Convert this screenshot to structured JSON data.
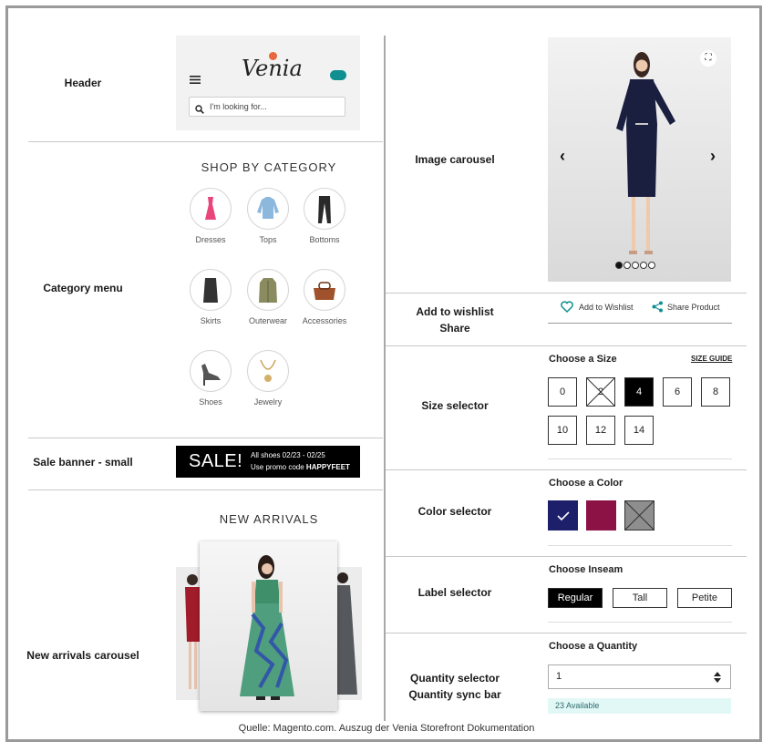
{
  "labels": {
    "header": "Header",
    "category_menu": "Category menu",
    "sale_banner": "Sale banner - small",
    "new_arrivals_carousel": "New arrivals carousel",
    "image_carousel": "Image carousel",
    "wishlist_share_1": "Add to wishlist",
    "wishlist_share_2": "Share",
    "size_selector": "Size selector",
    "color_selector": "Color selector",
    "label_selector": "Label selector",
    "quantity_1": "Quantity selector",
    "quantity_2": "Quantity sync bar"
  },
  "header": {
    "logo_text": "Venia",
    "search_placeholder": "I'm looking for...",
    "icons": [
      "hamburger-menu-icon",
      "search-icon",
      "cart-badge-icon"
    ]
  },
  "category": {
    "title": "SHOP BY CATEGORY",
    "items": [
      "Dresses",
      "Tops",
      "Bottoms",
      "Skirts",
      "Outerwear",
      "Accessories",
      "Shoes",
      "Jewelry"
    ]
  },
  "sale": {
    "big": "SALE!",
    "line1": "All shoes 02/23 - 02/25",
    "line2_prefix": "Use promo code ",
    "promo_code": "HAPPYFEET"
  },
  "new_arrivals": {
    "title": "NEW ARRIVALS"
  },
  "product": {
    "carousel_dots": 5,
    "active_dot": 0,
    "wishlist": "Add to Wishlist",
    "share": "Share Product",
    "size_title": "Choose a Size",
    "size_guide": "SIZE GUIDE",
    "sizes": [
      "0",
      "2",
      "4",
      "6",
      "8",
      "10",
      "12",
      "14"
    ],
    "selected_size": "4",
    "unavailable_size": "2",
    "color_title": "Choose a Color",
    "colors": [
      "#1e1f6b",
      "#8c1245",
      "#8e8e8e"
    ],
    "inseam_title": "Choose Inseam",
    "inseams": [
      "Regular",
      "Tall",
      "Petite"
    ],
    "selected_inseam": "Regular",
    "quantity_title": "Choose a Quantity",
    "quantity_value": "1",
    "available": "23 Available"
  },
  "caption": "Quelle: Magento.com. Auszug der Venia Storefront Dokumentation"
}
